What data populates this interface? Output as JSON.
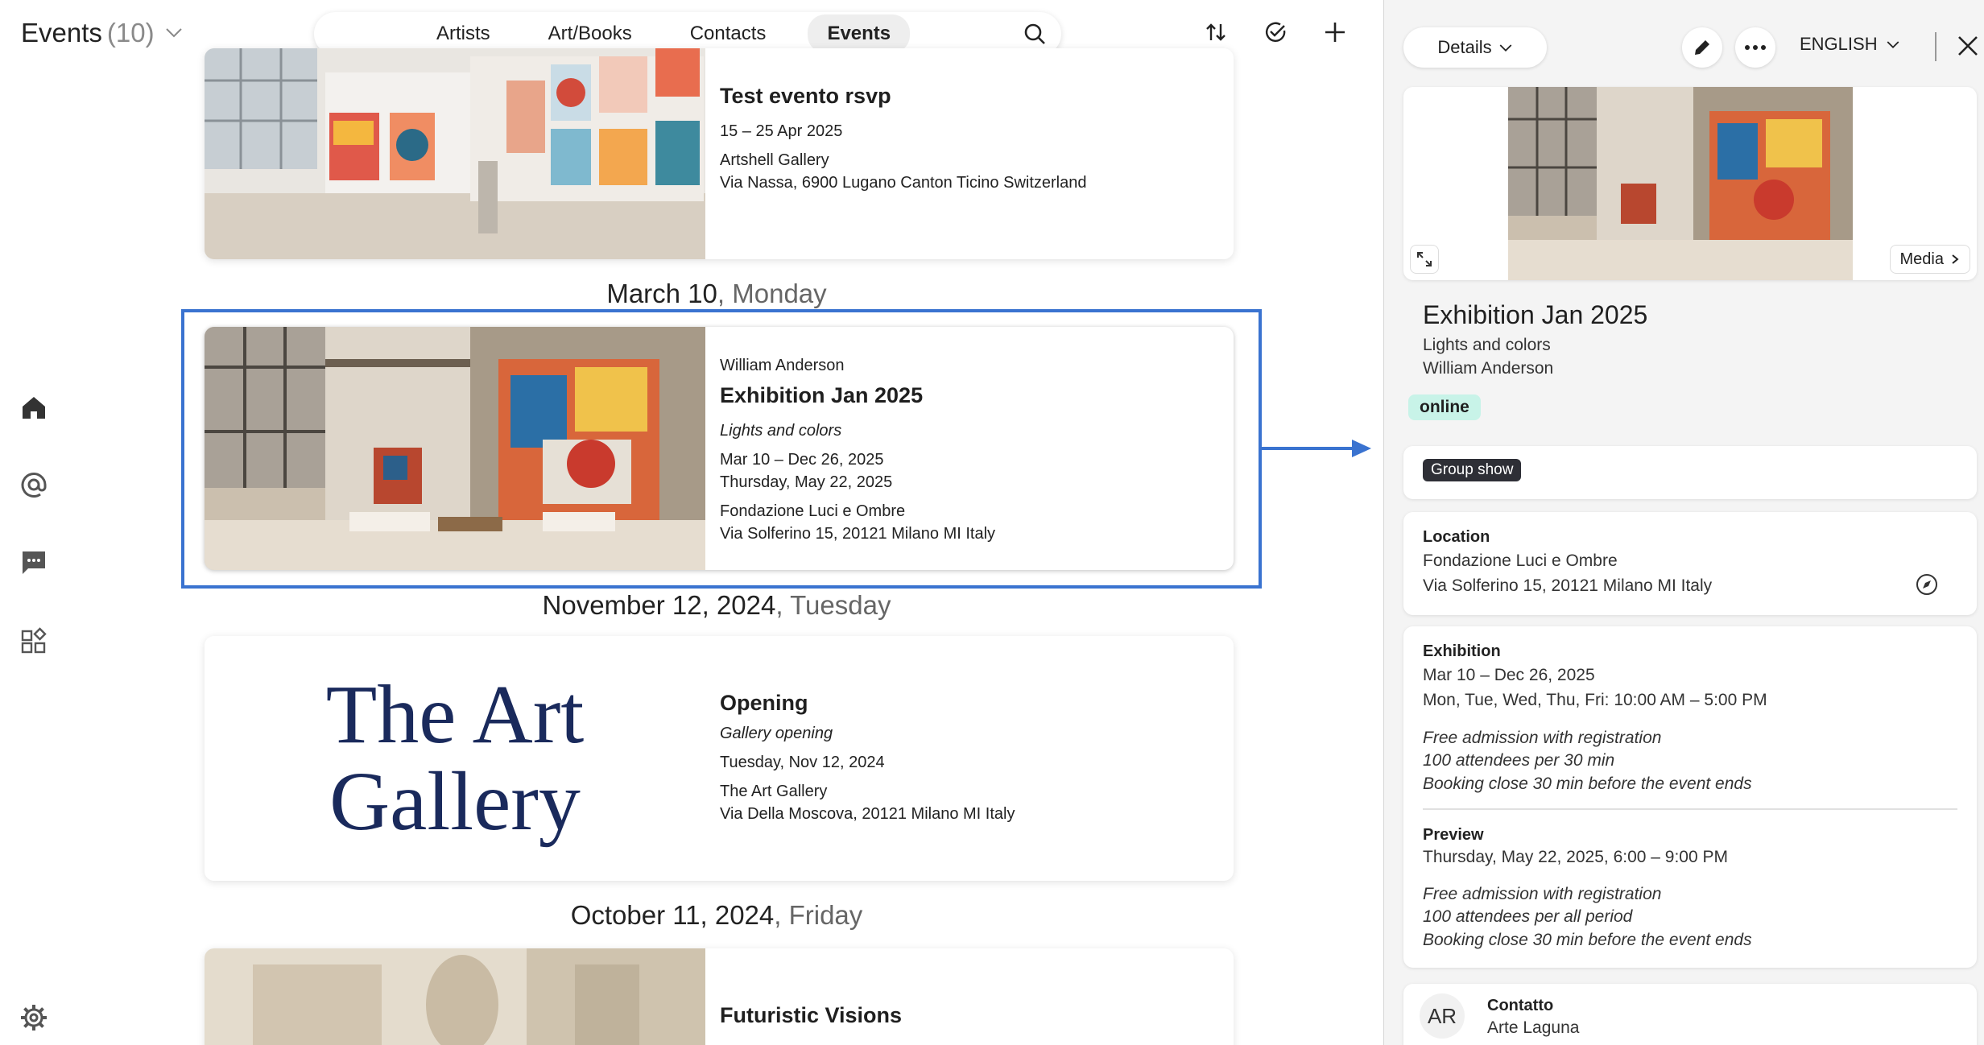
{
  "header": {
    "title": "Events",
    "count": "(10)",
    "tabs": [
      "Artists",
      "Art/Books",
      "Contacts",
      "Events"
    ],
    "active_tab": "Events"
  },
  "feed": {
    "card1": {
      "title": "Test evento rsvp",
      "dates": "15 – 25 Apr 2025",
      "venue": "Artshell Gallery",
      "address": "Via Nassa, 6900 Lugano Canton Ticino Switzerland"
    },
    "date1": {
      "date": "March 10",
      "weekday": ", Monday"
    },
    "card2": {
      "artist": "William Anderson",
      "title": "Exhibition Jan 2025",
      "subtitle": "Lights and colors",
      "dates": "Mar 10 – Dec 26, 2025",
      "preview": "Thursday, May 22, 2025",
      "venue": "Fondazione Luci e Ombre",
      "address": "Via Solferino 15, 20121 Milano MI Italy"
    },
    "date2": {
      "date": "November 12, 2024",
      "weekday": ", Tuesday"
    },
    "card3": {
      "logo_line1": "The Art",
      "logo_line2": "Gallery",
      "title": "Opening",
      "subtitle": "Gallery opening",
      "dates": "Tuesday, Nov 12, 2024",
      "venue": "The Art Gallery",
      "address": "Via Della Moscova, 20121 Milano MI Italy"
    },
    "date3": {
      "date": "October 11, 2024",
      "weekday": ", Friday"
    },
    "card4": {
      "title": "Futuristic Visions"
    }
  },
  "panel": {
    "details_label": "Details",
    "language": "ENGLISH",
    "media_label": "Media",
    "title": "Exhibition Jan 2025",
    "subtitle": "Lights and colors",
    "artist": "William Anderson",
    "status": "online",
    "tag": "Group show",
    "location_label": "Location",
    "location_venue": "Fondazione Luci e Ombre",
    "location_address": "Via Solferino 15, 20121 Milano MI Italy",
    "exhibition_label": "Exhibition",
    "exhibition_dates": "Mar 10 – Dec 26, 2025",
    "exhibition_hours": "Mon, Tue, Wed, Thu, Fri: 10:00 AM – 5:00 PM",
    "exhibition_note1": "Free admission with registration",
    "exhibition_note2": "100 attendees per 30 min",
    "exhibition_note3": "Booking close 30 min before the event ends",
    "preview_label": "Preview",
    "preview_date": "Thursday, May 22, 2025, 6:00 – 9:00 PM",
    "preview_note1": "Free admission with registration",
    "preview_note2": "100 attendees per all period",
    "preview_note3": "Booking close 30 min before the event ends",
    "contact_initials": "AR",
    "contact_label": "Contatto",
    "contact_name": "Arte Laguna"
  },
  "colors": {
    "accent_blue": "#3a73d0",
    "online_bg": "#c8f3e8",
    "tag_bg": "#2e2f36"
  }
}
